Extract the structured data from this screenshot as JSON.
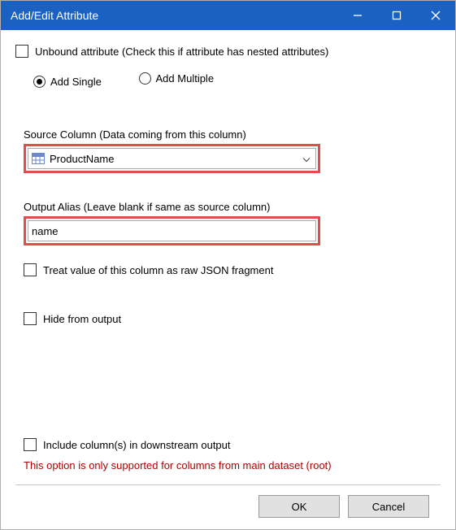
{
  "window": {
    "title": "Add/Edit Attribute"
  },
  "unbound": {
    "label": "Unbound attribute (Check this if attribute has nested attributes)",
    "checked": false
  },
  "mode": {
    "addSingle": "Add Single",
    "addMultiple": "Add Multiple",
    "selected": "single"
  },
  "sourceColumn": {
    "label": "Source Column (Data coming from this column)",
    "value": "ProductName"
  },
  "outputAlias": {
    "label": "Output Alias (Leave blank if same as source column)",
    "value": "name"
  },
  "rawJson": {
    "label": "Treat value of this column as raw JSON fragment",
    "checked": false
  },
  "hideOutput": {
    "label": "Hide from output",
    "checked": false
  },
  "includeDownstream": {
    "label": "Include column(s) in downstream output",
    "checked": false,
    "note": "This option is only supported for columns from main dataset (root)"
  },
  "buttons": {
    "ok": "OK",
    "cancel": "Cancel"
  }
}
